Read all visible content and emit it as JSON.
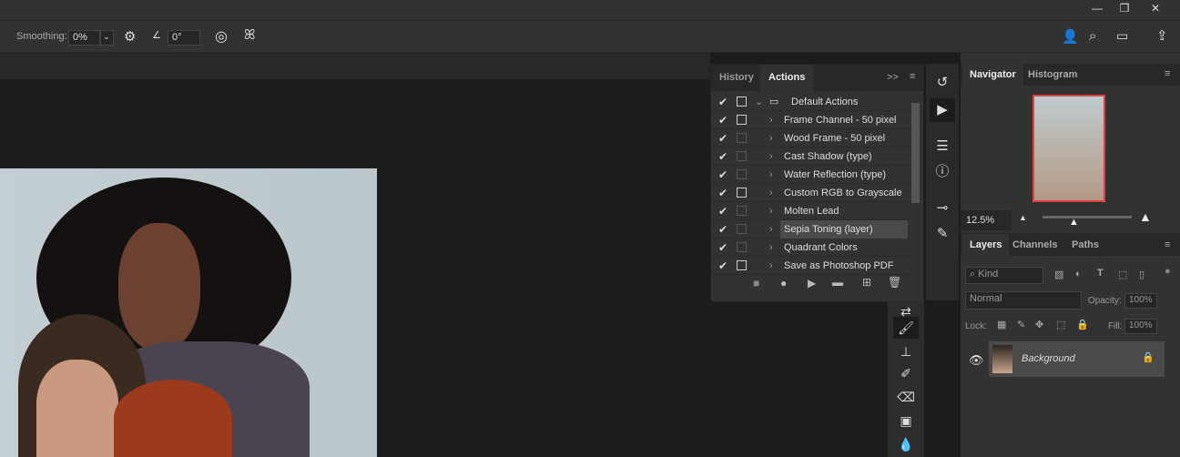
{
  "options_bar": {
    "smoothing_label": "Smoothing:",
    "smoothing_value": "0%",
    "angle_value": "0°"
  },
  "actions_panel": {
    "tabs": [
      "History",
      "Actions"
    ],
    "rows": [
      {
        "label": "Default Actions",
        "dialog": true,
        "set": true
      },
      {
        "label": "Frame Channel - 50 pixel",
        "dialog": true
      },
      {
        "label": "Wood Frame - 50 pixel",
        "dialog": false
      },
      {
        "label": "Cast Shadow (type)",
        "dialog": false
      },
      {
        "label": "Water Reflection (type)",
        "dialog": false
      },
      {
        "label": "Custom RGB to Grayscale",
        "dialog": true
      },
      {
        "label": "Molten Lead",
        "dialog": false
      },
      {
        "label": "Sepia Toning (layer)",
        "dialog": false,
        "selected": true
      },
      {
        "label": "Quadrant Colors",
        "dialog": false
      },
      {
        "label": "Save as Photoshop PDF",
        "dialog": true
      }
    ]
  },
  "navigator": {
    "tabs": [
      "Navigator",
      "Histogram"
    ],
    "zoom": "12.5%"
  },
  "layers": {
    "tabs": [
      "Layers",
      "Channels",
      "Paths"
    ],
    "filter": "Kind",
    "blend_mode": "Normal",
    "opacity_label": "Opacity:",
    "opacity": "100%",
    "lock_label": "Lock:",
    "fill_label": "Fill:",
    "fill": "100%",
    "items": [
      {
        "name": "Background"
      }
    ]
  },
  "colors": {
    "accent_red": "#e04040"
  }
}
